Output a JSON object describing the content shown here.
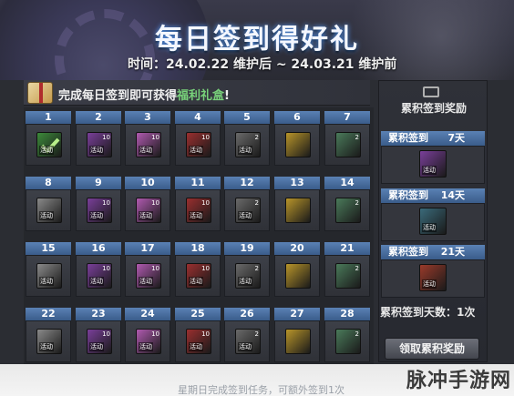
{
  "banner": {
    "title": "每日签到得好礼",
    "dates": "时间：24.02.22 维护后 ~ 24.03.21 维护前"
  },
  "header": {
    "text_pre": "完成每日签到即可获得",
    "text_highlight": "福利礼盒",
    "text_post": "!"
  },
  "days": [
    {
      "day": "1",
      "tag": "活动",
      "num": "",
      "color": "#3c8a3a",
      "icon": "check-icon"
    },
    {
      "day": "2",
      "tag": "活动",
      "num": "10",
      "color": "#7a3f9a",
      "icon": "gift-box-icon"
    },
    {
      "day": "3",
      "tag": "活动",
      "num": "10",
      "color": "#b05ab0",
      "icon": "gift-box-icon"
    },
    {
      "day": "4",
      "tag": "活动",
      "num": "10",
      "color": "#9a2f2f",
      "icon": "gift-box-icon"
    },
    {
      "day": "5",
      "tag": "活动",
      "num": "2",
      "color": "#6a6a6a",
      "icon": "scroll-icon"
    },
    {
      "day": "6",
      "tag": "",
      "num": "",
      "color": "#b8952a",
      "icon": "ticket-icon"
    },
    {
      "day": "7",
      "tag": "",
      "num": "2",
      "color": "#4a7a5a",
      "icon": "coin-icon"
    },
    {
      "day": "8",
      "tag": "活动",
      "num": "",
      "color": "#8a8a8a",
      "icon": "crystal-icon"
    },
    {
      "day": "9",
      "tag": "活动",
      "num": "10",
      "color": "#7a3f9a",
      "icon": "gift-box-icon"
    },
    {
      "day": "10",
      "tag": "活动",
      "num": "10",
      "color": "#b05ab0",
      "icon": "gift-box-icon"
    },
    {
      "day": "11",
      "tag": "活动",
      "num": "10",
      "color": "#9a2f2f",
      "icon": "gift-box-icon"
    },
    {
      "day": "12",
      "tag": "活动",
      "num": "2",
      "color": "#6a6a6a",
      "icon": "scroll-icon"
    },
    {
      "day": "13",
      "tag": "",
      "num": "",
      "color": "#b8952a",
      "icon": "ticket-icon"
    },
    {
      "day": "14",
      "tag": "",
      "num": "2",
      "color": "#4a7a5a",
      "icon": "coin-icon"
    },
    {
      "day": "15",
      "tag": "活动",
      "num": "",
      "color": "#8a8a8a",
      "icon": "crystal-icon"
    },
    {
      "day": "16",
      "tag": "活动",
      "num": "10",
      "color": "#7a3f9a",
      "icon": "gift-box-icon"
    },
    {
      "day": "17",
      "tag": "活动",
      "num": "10",
      "color": "#b05ab0",
      "icon": "gift-box-icon"
    },
    {
      "day": "18",
      "tag": "活动",
      "num": "10",
      "color": "#9a2f2f",
      "icon": "gift-box-icon"
    },
    {
      "day": "19",
      "tag": "活动",
      "num": "2",
      "color": "#6a6a6a",
      "icon": "scroll-icon"
    },
    {
      "day": "20",
      "tag": "",
      "num": "",
      "color": "#b8952a",
      "icon": "ticket-icon"
    },
    {
      "day": "21",
      "tag": "",
      "num": "2",
      "color": "#4a7a5a",
      "icon": "coin-icon"
    },
    {
      "day": "22",
      "tag": "活动",
      "num": "",
      "color": "#8a8a8a",
      "icon": "crystal-icon"
    },
    {
      "day": "23",
      "tag": "活动",
      "num": "10",
      "color": "#7a3f9a",
      "icon": "gift-box-icon"
    },
    {
      "day": "24",
      "tag": "活动",
      "num": "10",
      "color": "#b05ab0",
      "icon": "gift-box-icon"
    },
    {
      "day": "25",
      "tag": "活动",
      "num": "10",
      "color": "#9a2f2f",
      "icon": "gift-box-icon"
    },
    {
      "day": "26",
      "tag": "活动",
      "num": "2",
      "color": "#6a6a6a",
      "icon": "scroll-icon"
    },
    {
      "day": "27",
      "tag": "",
      "num": "",
      "color": "#b8952a",
      "icon": "ticket-icon"
    },
    {
      "day": "28",
      "tag": "",
      "num": "2",
      "color": "#4a7a5a",
      "icon": "coin-icon"
    }
  ],
  "cumulative": {
    "title": "累积签到奖励",
    "rewards": [
      {
        "label": "累积签到",
        "days": "7天",
        "tag": "活动",
        "color": "#7a3f9a"
      },
      {
        "label": "累积签到",
        "days": "14天",
        "tag": "活动",
        "color": "#3a6a7a"
      },
      {
        "label": "累积签到",
        "days": "21天",
        "tag": "活动",
        "color": "#9a3a2a"
      }
    ],
    "days_count": "累积签到天数：1次",
    "claim_label": "领取累积奖励"
  },
  "footer": {
    "text": "星期日完成签到任务，可额外签到1次",
    "watermark": "脉冲手游网"
  }
}
